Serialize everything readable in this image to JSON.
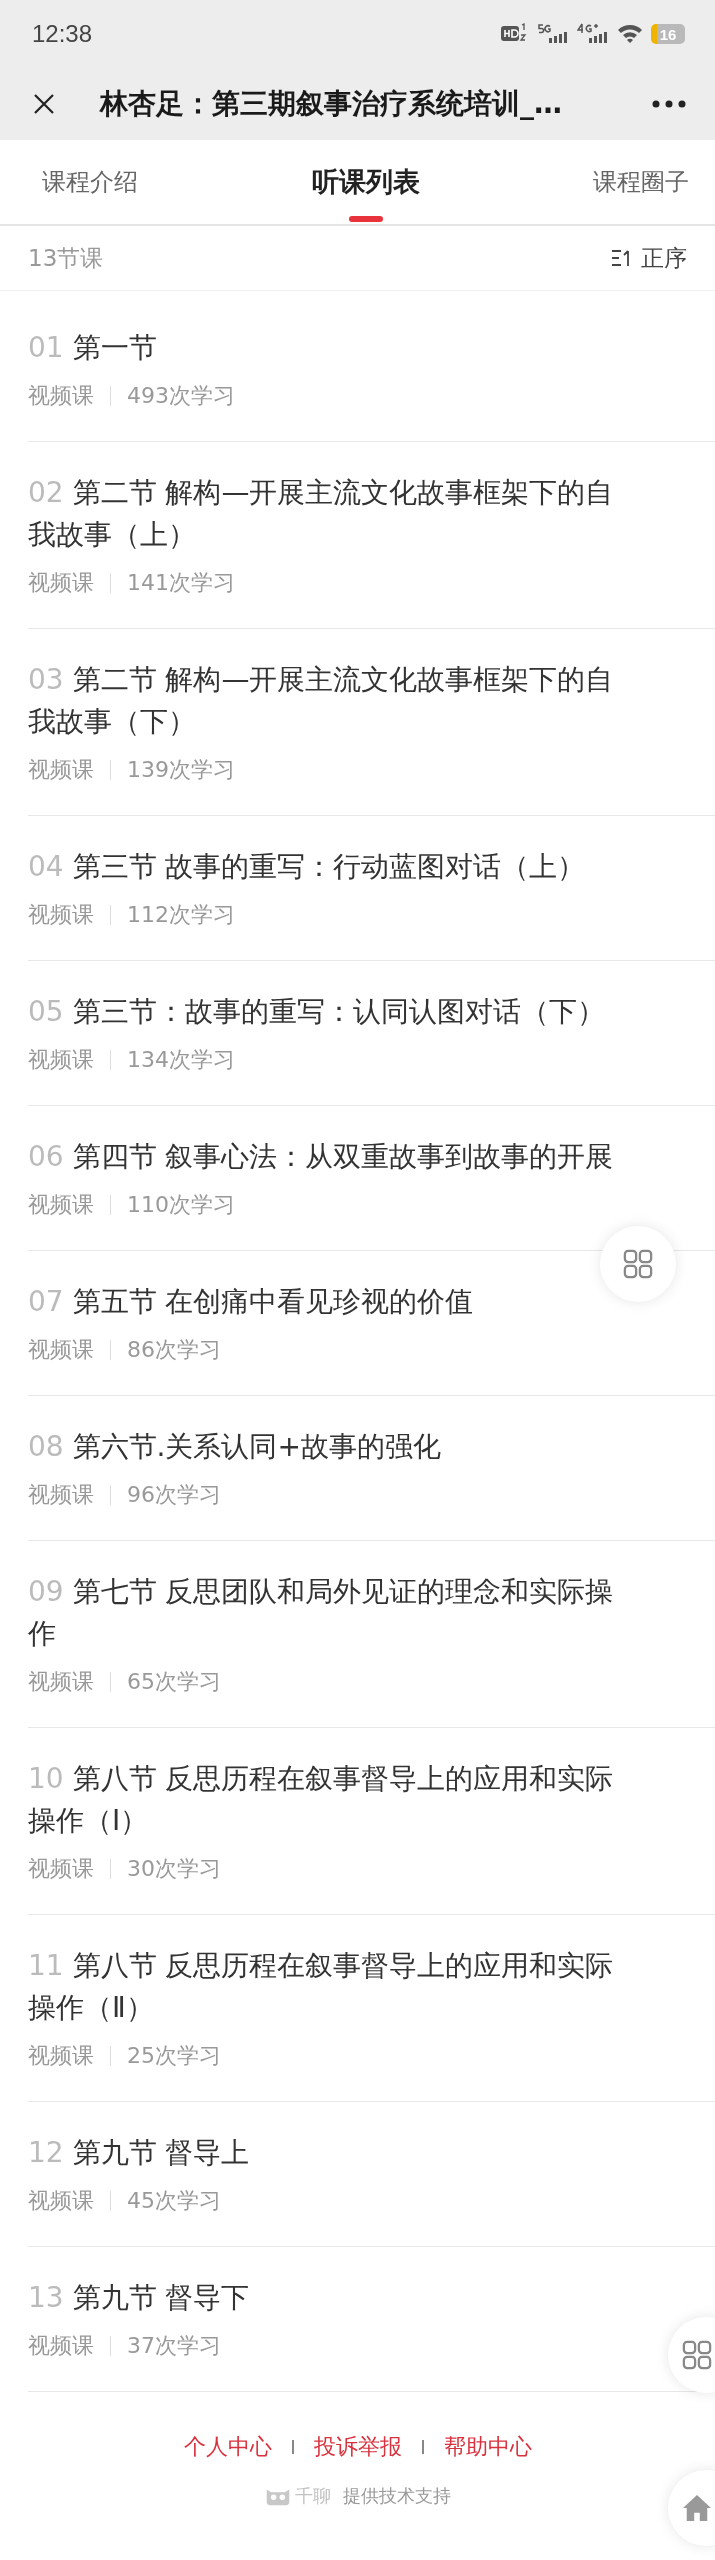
{
  "status_bar": {
    "time": "12:38",
    "battery": "16"
  },
  "header": {
    "title": "林杏足：第三期叙事治疗系统培训_…"
  },
  "tabs": [
    {
      "label": "课程介绍",
      "selected": false
    },
    {
      "label": "听课列表",
      "selected": true
    },
    {
      "label": "课程圈子",
      "selected": false
    }
  ],
  "list_header": {
    "count": "13节课",
    "sort": "正序"
  },
  "lessons": [
    {
      "number": "01",
      "title": "第一节",
      "type": "视频课",
      "views": "493次学习"
    },
    {
      "number": "02",
      "title": "第二节 解构—开展主流文化故事框架下的自我故事（上）",
      "type": "视频课",
      "views": "141次学习"
    },
    {
      "number": "03",
      "title": "第二节 解构—开展主流文化故事框架下的自我故事（下）",
      "type": "视频课",
      "views": "139次学习"
    },
    {
      "number": "04",
      "title": "第三节 故事的重写：行动蓝图对话（上）",
      "type": "视频课",
      "views": "112次学习"
    },
    {
      "number": "05",
      "title": "第三节：故事的重写：认同认图对话（下）",
      "type": "视频课",
      "views": "134次学习"
    },
    {
      "number": "06",
      "title": "第四节 叙事心法：从双重故事到故事的开展",
      "type": "视频课",
      "views": "110次学习"
    },
    {
      "number": "07",
      "title": "第五节 在创痛中看见珍视的价值",
      "type": "视频课",
      "views": "86次学习"
    },
    {
      "number": "08",
      "title": "第六节.关系认同+故事的强化",
      "type": "视频课",
      "views": "96次学习"
    },
    {
      "number": "09",
      "title": "第七节 反思团队和局外见证的理念和实际操作",
      "type": "视频课",
      "views": "65次学习"
    },
    {
      "number": "10",
      "title": "第八节 反思历程在叙事督导上的应用和实际操作（Ⅰ）",
      "type": "视频课",
      "views": "30次学习"
    },
    {
      "number": "11",
      "title": "第八节 反思历程在叙事督导上的应用和实际操作（Ⅱ）",
      "type": "视频课",
      "views": "25次学习"
    },
    {
      "number": "12",
      "title": "第九节 督导上",
      "type": "视频课",
      "views": "45次学习"
    },
    {
      "number": "13",
      "title": "第九节 督导下",
      "type": "视频课",
      "views": "37次学习"
    }
  ],
  "footer": {
    "links": [
      "个人中心",
      "投诉举报",
      "帮助中心"
    ],
    "brand": "千聊",
    "credit": "提供技术支持"
  }
}
